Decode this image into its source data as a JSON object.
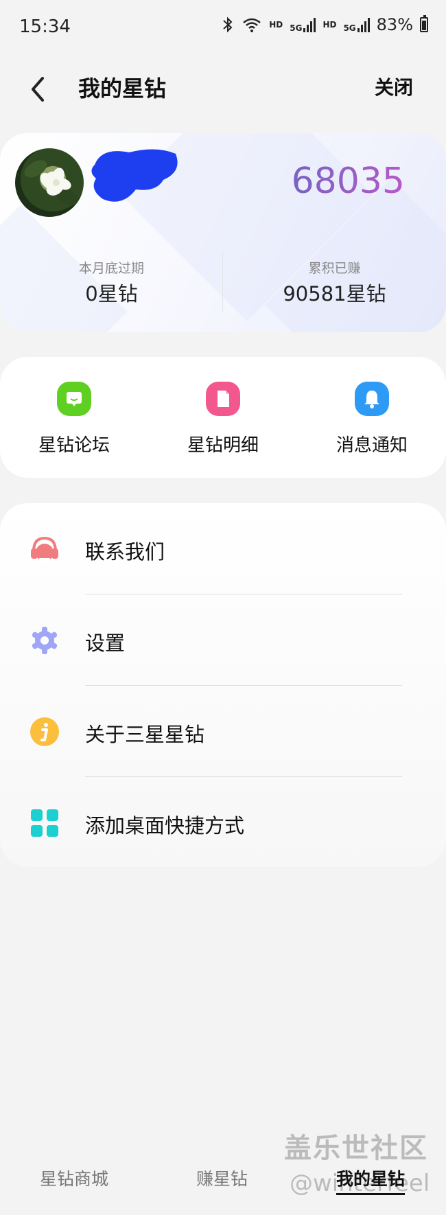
{
  "status_bar": {
    "time": "15:34",
    "battery": "83%",
    "hd1": "HD",
    "hd2": "HD",
    "net1": "5G",
    "net2": "5G"
  },
  "header": {
    "title": "我的星钻",
    "close_label": "关闭"
  },
  "profile": {
    "balance": "68035",
    "stats": [
      {
        "label": "本月底过期",
        "value": "0星钻"
      },
      {
        "label": "累积已赚",
        "value": "90581星钻"
      }
    ]
  },
  "quick_actions": [
    {
      "label": "星钻论坛",
      "icon": "chat-icon",
      "color": "#5fd022"
    },
    {
      "label": "星钻明细",
      "icon": "document-icon",
      "color": "#f2578e"
    },
    {
      "label": "消息通知",
      "icon": "bell-icon",
      "color": "#2d9bf5"
    }
  ],
  "menu": [
    {
      "label": "联系我们",
      "icon": "headset-icon",
      "color": "#f07c80"
    },
    {
      "label": "设置",
      "icon": "gear-icon",
      "color": "#9ea6f5"
    },
    {
      "label": "关于三星星钻",
      "icon": "info-icon",
      "color": "#fbbe3d"
    },
    {
      "label": "添加桌面快捷方式",
      "icon": "grid-icon",
      "color": "#1ccfd0"
    }
  ],
  "bottom_nav": [
    {
      "label": "星钻商城",
      "active": false
    },
    {
      "label": "赚星钻",
      "active": false
    },
    {
      "label": "我的星钻",
      "active": true
    }
  ],
  "watermark": {
    "line1": "盖乐世社区",
    "line2": "@winterfeel"
  }
}
